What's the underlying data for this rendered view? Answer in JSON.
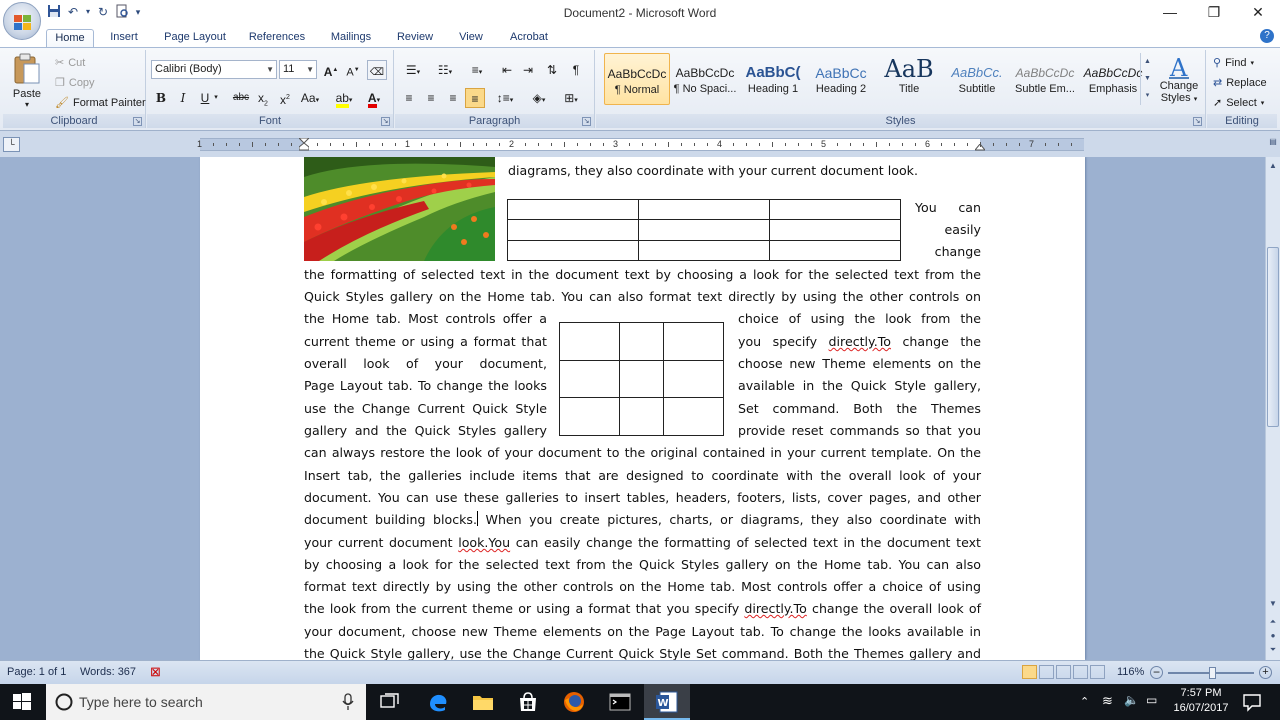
{
  "window": {
    "title": "Document2 - Microsoft Word",
    "controls": {
      "minimize": "—",
      "restore": "❐",
      "close": "✕"
    }
  },
  "tabs": [
    {
      "label": "Home",
      "active": true
    },
    {
      "label": "Insert"
    },
    {
      "label": "Page Layout"
    },
    {
      "label": "References"
    },
    {
      "label": "Mailings"
    },
    {
      "label": "Review"
    },
    {
      "label": "View"
    },
    {
      "label": "Acrobat"
    }
  ],
  "ribbon": {
    "clipboard": {
      "label": "Clipboard",
      "paste": "Paste",
      "cut": "Cut",
      "copy": "Copy",
      "format_painter": "Format Painter"
    },
    "font": {
      "label": "Font",
      "font_name": "Calibri (Body)",
      "font_size": "11"
    },
    "paragraph": {
      "label": "Paragraph"
    },
    "styles": {
      "label": "Styles",
      "items": [
        {
          "sample": "AaBbCcDc",
          "name": "¶ Normal"
        },
        {
          "sample": "AaBbCcDc",
          "name": "¶ No Spaci..."
        },
        {
          "sample": "AaBbC(",
          "name": "Heading 1"
        },
        {
          "sample": "AaBbCc",
          "name": "Heading 2"
        },
        {
          "sample": "AaB",
          "name": "Title"
        },
        {
          "sample": "AaBbCc.",
          "name": "Subtitle"
        },
        {
          "sample": "AaBbCcDc",
          "name": "Subtle Em..."
        },
        {
          "sample": "AaBbCcDc",
          "name": "Emphasis"
        }
      ],
      "change_styles_line1": "Change",
      "change_styles_line2": "Styles"
    },
    "editing": {
      "label": "Editing",
      "find": "Find",
      "replace": "Replace",
      "select": "Select"
    }
  },
  "ruler": {
    "numbers": [
      "1",
      "1",
      "2",
      "3",
      "4",
      "5",
      "6",
      "7"
    ]
  },
  "document": {
    "line_top": "diagrams, they also coordinate with your current document look.",
    "you_can": "You can",
    "easily": "easily",
    "change": "change",
    "full1": "the formatting of selected text in the document text by choosing a look for the selected text from the",
    "full2": "Quick Styles gallery on the Home tab. You can also format text directly by using the other controls on",
    "left_col": [
      "the Home tab. Most controls offer a",
      "current theme or using a format that",
      "overall look of your document,",
      "Page Layout tab. To change the looks",
      "use the Change Current Quick Style",
      "gallery and the Quick Styles gallery"
    ],
    "right_col": [
      "choice of using the look from the",
      "you specify ",
      "choose new Theme elements on the",
      "available in the Quick Style gallery,",
      "Set command. Both the Themes",
      "provide reset commands so that you"
    ],
    "right_col_wavy": "directly.To",
    "right_col_tail": " change the",
    "full3": "can always restore the look of your document to the original contained in your current template. On the",
    "full4": "Insert tab, the galleries include items that are designed to coordinate with the overall look of your",
    "full5": "document. You can use these galleries to insert tables, headers, footers, lists, cover pages, and other",
    "full6a": "document building blocks.",
    "full6b": " When you create pictures, charts, or diagrams, they also coordinate with",
    "full7a": "your current document ",
    "full7wavy": "look.You",
    "full7b": " can easily change the formatting of selected text in the document text",
    "full8": "by choosing a look for the selected text from the Quick Styles gallery on the Home tab. You can also",
    "full9": "format text directly by using the other controls on the Home tab. Most controls offer a choice of using",
    "full10a": "the look from the current theme or using a format that you specify ",
    "full10wavy": "directly.To",
    "full10b": " change the overall look of",
    "full11": "your document, choose new Theme elements on the Page Layout tab. To change the looks available in",
    "full12": "the Quick Style gallery, use the Change Current Quick Style Set command. Both the Themes gallery and"
  },
  "statusbar": {
    "page": "Page: 1 of 1",
    "words": "Words: 367",
    "zoom": "116%"
  },
  "taskbar": {
    "search_placeholder": "Type here to search",
    "time": "7:57 PM",
    "date": "16/07/2017"
  }
}
